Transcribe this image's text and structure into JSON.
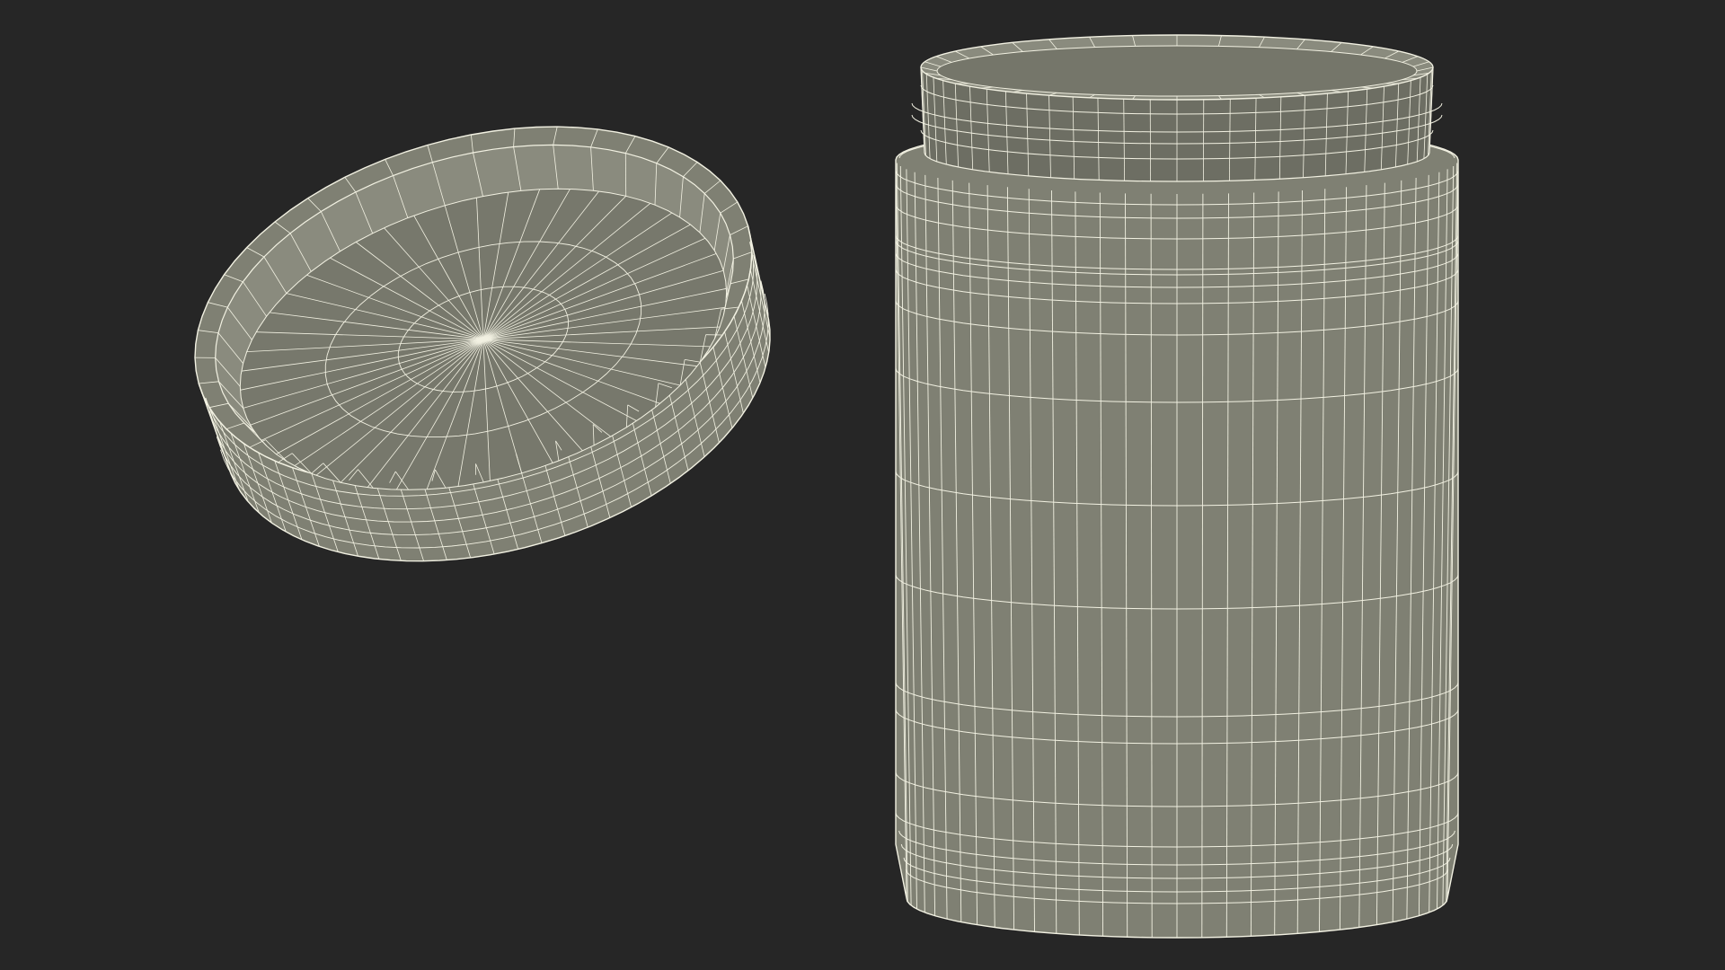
{
  "scene": {
    "background_color": "#262626",
    "surface_color": "#7f8073",
    "surface_shadow_color": "#6d6e63",
    "inner_color": "#8a8b7e",
    "wire_color": "#f2f1e2",
    "objects": [
      {
        "name": "lid",
        "shape": "open jar lid",
        "render": "wireframe"
      },
      {
        "name": "jar",
        "shape": "open cylindrical jar",
        "render": "wireframe"
      }
    ]
  }
}
